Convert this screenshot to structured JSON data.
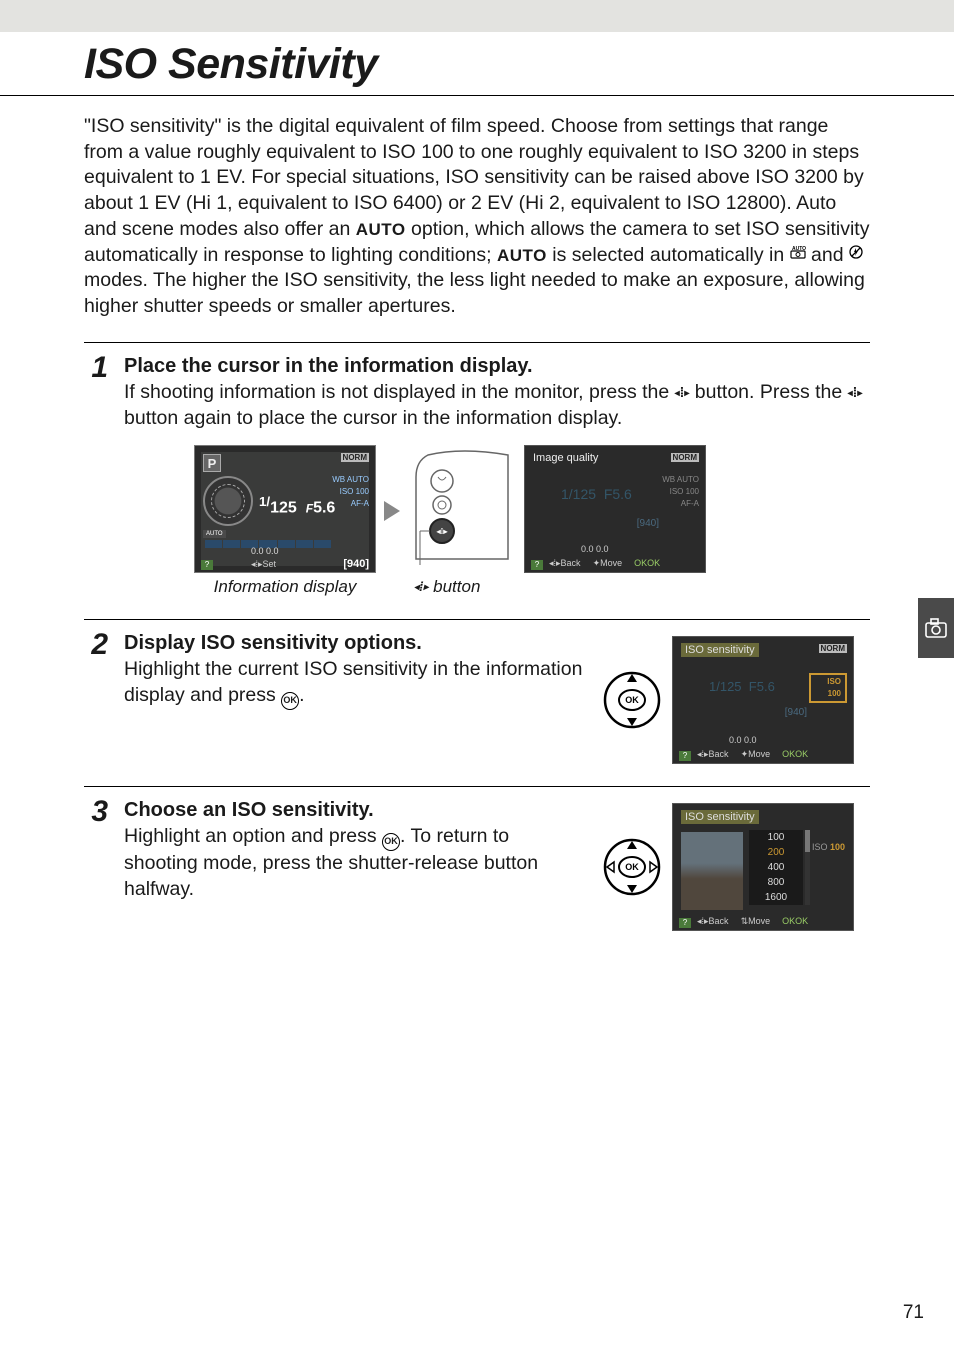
{
  "page": {
    "title": "ISO Sensitivity",
    "intro_1": "\"ISO sensitivity\" is the digital equivalent of film speed.  Choose from settings that range from a value roughly equivalent to ISO 100 to one roughly equivalent to ISO 3200 in steps equivalent to 1 EV.  For special situations, ISO sensitivity can be raised above ISO 3200 by about 1 EV (Hi 1, equivalent to ISO 6400) or 2 EV (Hi 2, equivalent to ISO 12800).  Auto and scene modes also offer an ",
    "intro_auto1": "AUTO",
    "intro_2": " option, which allows the camera to set ISO sensitivity automatically in response to lighting conditions; ",
    "intro_auto2": "AUTO",
    "intro_3": " is selected automatically in ",
    "intro_4": " and ",
    "intro_5": " modes.  The higher the ISO sensitivity, the less light needed to make an exposure, allowing higher shutter speeds or smaller apertures.",
    "page_number": "71"
  },
  "steps": {
    "s1": {
      "num": "1",
      "title": "Place the cursor in the information display.",
      "text_a": "If shooting information is not displayed in the monitor, press the ",
      "text_b": " button. Press the ",
      "text_c": " button again to place the cursor in the information display.",
      "caption_info": "Information display",
      "caption_btn": " button"
    },
    "s2": {
      "num": "2",
      "title": "Display ISO sensitivity options.",
      "text_a": "Highlight the current ISO sensitivity in the information display and press ",
      "text_b": "."
    },
    "s3": {
      "num": "3",
      "title": "Choose an ISO sensitivity.",
      "text_a": "Highlight an option and press ",
      "text_b": ".  To return to shooting mode, press the shutter-release button halfway."
    }
  },
  "lcd1": {
    "mode": "P",
    "shutter_pre": "1/",
    "shutter": "125",
    "f_pre": "F",
    "aperture": "5.6",
    "auto_pill": "AUTO",
    "norm": "NORM",
    "wb": "WB AUTO",
    "iso_label": "ISO",
    "iso": "100",
    "af": "AF-A",
    "b_row": "0.0      0.0",
    "set": "Set",
    "count": "[940]",
    "help": "?"
  },
  "lcd2": {
    "title": "Image quality",
    "shutter": "1/125",
    "aperture": "F5.6",
    "norm": "NORM",
    "wb": "WB AUTO",
    "iso_label": "ISO",
    "iso": "100",
    "af": "AF-A",
    "count": "[940]",
    "b_row": "0.0      0.0",
    "back": "Back",
    "move": "Move",
    "ok": "OK",
    "help": "?"
  },
  "lcd3": {
    "title": "ISO sensitivity",
    "shutter": "1/125",
    "aperture": "F5.6",
    "norm": "NORM",
    "iso_label": "ISO",
    "iso_hl": "100",
    "count": "[940]",
    "b_row": "0.0      0.0",
    "back": "Back",
    "move": "Move",
    "ok": "OK",
    "help": "?"
  },
  "lcd4": {
    "title": "ISO sensitivity",
    "options": [
      "100",
      "200",
      "400",
      "800",
      "1600"
    ],
    "selected_index": 1,
    "iso_label": "ISO",
    "iso_side": "100",
    "back": "Back",
    "move": "Move",
    "ok": "OK",
    "help": "?"
  }
}
